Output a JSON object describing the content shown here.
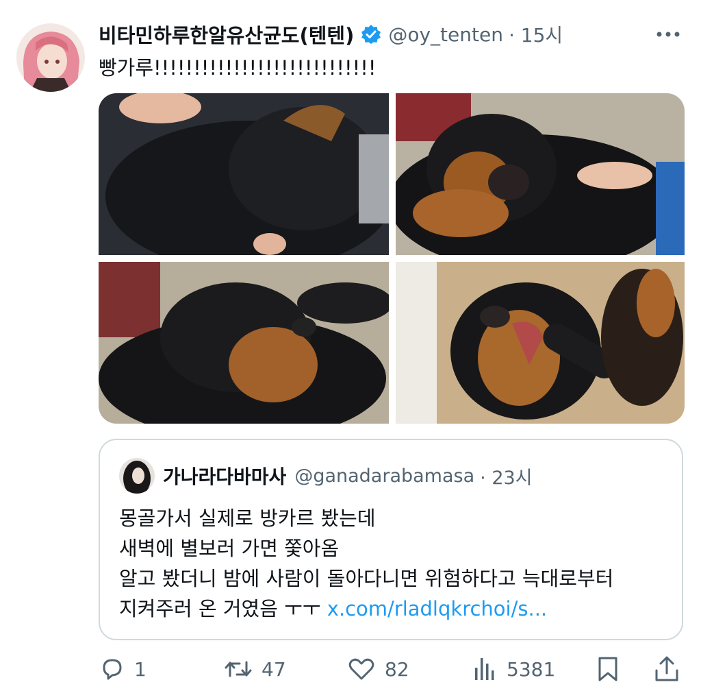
{
  "tweet": {
    "author_name": "비타민하루한알유산균도(텐텐)",
    "handle": "@oy_tenten",
    "time": "· 15시",
    "text": "빵가루!!!!!!!!!!!!!!!!!!!!!!!!!!!!"
  },
  "quote": {
    "author_name": "가나라다바마사",
    "handle": "@ganadarabamasa",
    "time": "· 23시",
    "lines": [
      "몽골가서 실제로 방카르 봤는데",
      "새벽에 별보러 가면 쫓아옴",
      "알고 봤더니 밤에 사람이 돌아다니면 위험하다고 늑대로부터"
    ],
    "last_line_text": "지켜주러 온 거였음 ㅜㅜ ",
    "link": "x.com/rladlqkrchoi/s..."
  },
  "actions": {
    "reply_count": "1",
    "retweet_count": "47",
    "like_count": "82",
    "view_count": "5381"
  },
  "icons": {
    "verified": "verified-badge-icon",
    "more": "more-horizontal-icon",
    "reply": "reply-icon",
    "retweet": "retweet-icon",
    "like": "heart-icon",
    "views": "views-bar-chart-icon",
    "bookmark": "bookmark-icon",
    "share": "share-icon"
  },
  "colors": {
    "text": "#0f1419",
    "secondary": "#536471",
    "link": "#1d9bf0",
    "border": "#cfd9de"
  }
}
